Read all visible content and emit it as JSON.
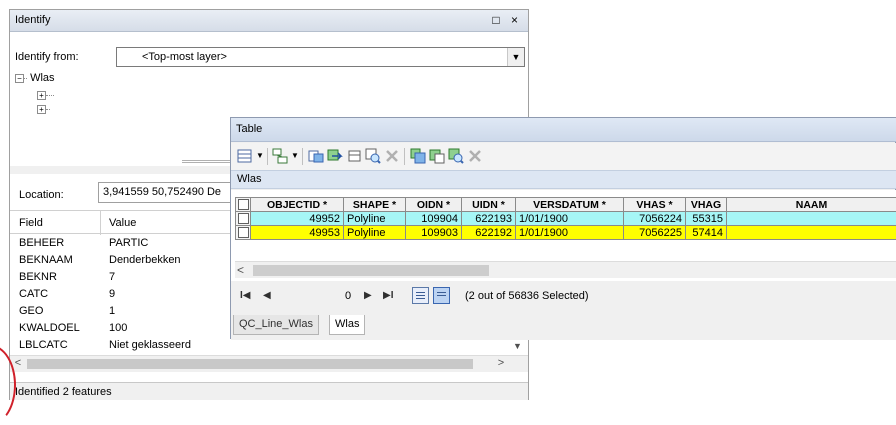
{
  "identify": {
    "title": "Identify",
    "window_buttons": "□ ×",
    "from_label": "Identify from:",
    "from_value": "<Top-most layer>",
    "tree_root": "Wlas",
    "location_label": "Location:",
    "location_value": "3,941559  50,752490 De",
    "col_field": "Field",
    "col_value": "Value",
    "rows": [
      {
        "field": "BEHEER",
        "value": "PARTIC"
      },
      {
        "field": "BEKNAAM",
        "value": "Denderbekken"
      },
      {
        "field": "BEKNR",
        "value": "7"
      },
      {
        "field": "CATC",
        "value": "9"
      },
      {
        "field": "GEO",
        "value": "1"
      },
      {
        "field": "KWALDOEL",
        "value": "100"
      },
      {
        "field": "LBLCATC",
        "value": "Niet geklasseerd"
      }
    ],
    "status": "Identified 2 features"
  },
  "table": {
    "title": "Table",
    "layer": "Wlas",
    "columns": [
      "OBJECTID *",
      "SHAPE *",
      "OIDN *",
      "UIDN *",
      "VERSDATUM *",
      "VHAS *",
      "VHAG",
      "NAAM"
    ],
    "rows": [
      [
        "49952",
        "Polyline",
        "109904",
        "622193",
        "1/01/1900",
        "7056224",
        "55315",
        ""
      ],
      [
        "49953",
        "Polyline",
        "109903",
        "622192",
        "1/01/1900",
        "7056225",
        "57414",
        ""
      ]
    ],
    "record": "0",
    "selection_info": "(2 out of 56836 Selected)",
    "tabs": [
      "QC_Line_Wlas",
      "Wlas"
    ]
  },
  "colors": {
    "row_selected_cyan": "#a6f6f6",
    "row_highlight_yellow": "#ffff00"
  }
}
